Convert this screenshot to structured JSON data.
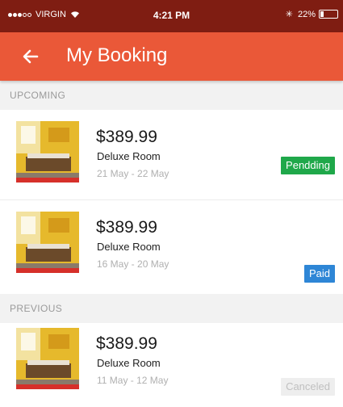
{
  "status_bar": {
    "carrier": "VIRGIN",
    "time": "4:21 PM",
    "bluetooth": "✳",
    "battery": "22%",
    "battery_level": 0.22
  },
  "app_bar": {
    "title": "My Booking",
    "color": "#ea5838"
  },
  "sections": {
    "upcoming": "UPCOMING",
    "previous": "PREVIOUS"
  },
  "bookings": [
    {
      "price": "$389.99",
      "room": "Deluxe Room",
      "dates": "21 May - 22 May",
      "status": "Pendding",
      "status_color": "#1fa84a"
    },
    {
      "price": "$389.99",
      "room": "Deluxe Room",
      "dates": "16 May - 20 May",
      "status": "Paid",
      "status_color": "#2e86d6"
    },
    {
      "price": "$389.99",
      "room": "Deluxe Room",
      "dates": "11 May - 12 May",
      "status": "Canceled",
      "status_color": "#eeeeee"
    }
  ],
  "icons": {
    "back": "arrow-left-icon",
    "wifi": "wifi-icon",
    "battery": "battery-icon"
  }
}
